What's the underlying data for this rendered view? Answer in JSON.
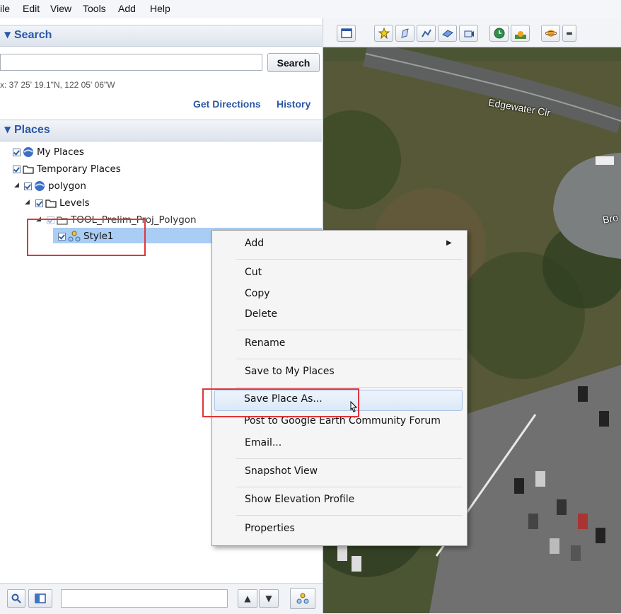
{
  "menubar": {
    "items": [
      "File",
      "Edit",
      "View",
      "Tools",
      "Add",
      "Help"
    ],
    "visible_text": [
      "ile",
      "Edit",
      "View",
      "Tools",
      "Add",
      "Help"
    ]
  },
  "search_panel": {
    "title": "Search",
    "input_value": "",
    "button_label": "Search",
    "coords_text": "x: 37 25' 19.1\"N, 122 05' 06\"W",
    "get_directions": "Get Directions",
    "history": "History"
  },
  "places_panel": {
    "title": "Places",
    "tree": [
      {
        "label": "My Places",
        "icon": "globe-icon"
      },
      {
        "label": "Temporary Places",
        "icon": "folder-icon"
      },
      {
        "label": "polygon",
        "icon": "globe-icon"
      },
      {
        "label": "Levels",
        "icon": "folder-icon"
      },
      {
        "label": "TOOL_Prelim_Proj_Polygon",
        "icon": "folder-icon"
      },
      {
        "label": "Style1",
        "icon": "style-dots-icon"
      }
    ]
  },
  "map": {
    "street_labels": [
      "Edgewater Cir",
      "Bro"
    ]
  },
  "context_menu": {
    "items": {
      "add": "Add",
      "cut": "Cut",
      "copy": "Copy",
      "delete": "Delete",
      "rename": "Rename",
      "save_to_my_places": "Save to My Places",
      "save_place_as": "Save Place As...",
      "post_forum": "Post to Google Earth Community Forum",
      "email": "Email...",
      "snapshot_view": "Snapshot View",
      "show_elevation_profile": "Show Elevation Profile",
      "properties": "Properties"
    },
    "highlighted": "Save Place As..."
  },
  "colors": {
    "accent_blue": "#2b57a5",
    "selection": "#a9cdf5",
    "annotation_red": "#e0353c"
  }
}
